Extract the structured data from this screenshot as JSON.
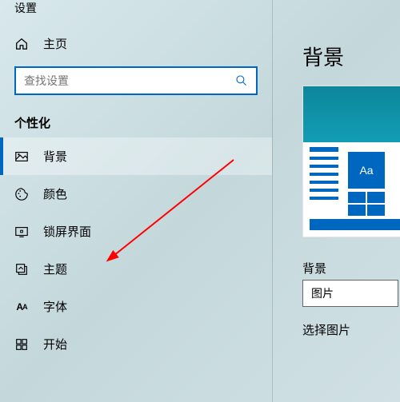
{
  "header": {
    "truncated": "设置"
  },
  "home": {
    "label": "主页"
  },
  "search": {
    "placeholder": "查找设置"
  },
  "section": {
    "title": "个性化"
  },
  "nav": {
    "items": [
      {
        "label": "背景"
      },
      {
        "label": "颜色"
      },
      {
        "label": "锁屏界面"
      },
      {
        "label": "主题"
      },
      {
        "label": "字体"
      },
      {
        "label": "开始"
      }
    ]
  },
  "content": {
    "title": "背景",
    "preview_tile_text": "Aa",
    "bg_label": "背景",
    "bg_value": "图片",
    "select_label": "选择图片"
  }
}
